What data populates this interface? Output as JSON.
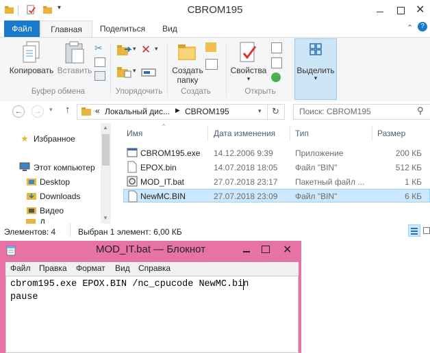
{
  "explorer": {
    "title": "CBROM195",
    "tabs": {
      "file": "Файл",
      "home": "Главная",
      "share": "Поделиться",
      "view": "Вид"
    },
    "ribbon": {
      "copy": "Копировать",
      "paste": "Вставить",
      "clipboard_group": "Буфер обмена",
      "organize_group": "Упорядочить",
      "new_folder_line1": "Создать",
      "new_folder_line2": "папку",
      "create_group": "Создать",
      "properties": "Свойства",
      "open_group": "Открыть",
      "select": "Выделить"
    },
    "address": {
      "prefix": "«",
      "crumb1": "Локальный дис...",
      "crumb2": "CBROM195",
      "search_placeholder": "Поиск: CBROM195"
    },
    "nav": {
      "favorites": "Избранное",
      "this_pc": "Этот компьютер",
      "desktop": "Desktop",
      "downloads": "Downloads",
      "video": "Видео",
      "cut": "Д"
    },
    "columns": {
      "name": "Имя",
      "date": "Дата изменения",
      "type": "Тип",
      "size": "Размер"
    },
    "files": [
      {
        "name": "CBROM195.exe",
        "date": "14.12.2006 9:39",
        "type": "Приложение",
        "size": "200 КБ"
      },
      {
        "name": "EPOX.bin",
        "date": "14.07.2018 18:05",
        "type": "Файл \"BIN\"",
        "size": "512 КБ"
      },
      {
        "name": "MOD_IT.bat",
        "date": "27.07.2018 23:17",
        "type": "Пакетный файл ...",
        "size": "1 КБ"
      },
      {
        "name": "NewMC.BIN",
        "date": "27.07.2018 23:09",
        "type": "Файл \"BIN\"",
        "size": "6 КБ"
      }
    ],
    "status": {
      "items": "Элементов: 4",
      "selected": "Выбран 1 элемент: 6,00 КБ"
    }
  },
  "notepad": {
    "title": "MOD_IT.bat — Блокнот",
    "menu": [
      "Файл",
      "Правка",
      "Формат",
      "Вид",
      "Справка"
    ],
    "lines": [
      "cbrom195.exe EPOX.BIN /nc_cpucode NewMC.bin",
      "pause"
    ]
  },
  "colors": {
    "accent": "#1979ca",
    "notepad_frame": "#e773a6",
    "selection": "#cce8ff"
  }
}
